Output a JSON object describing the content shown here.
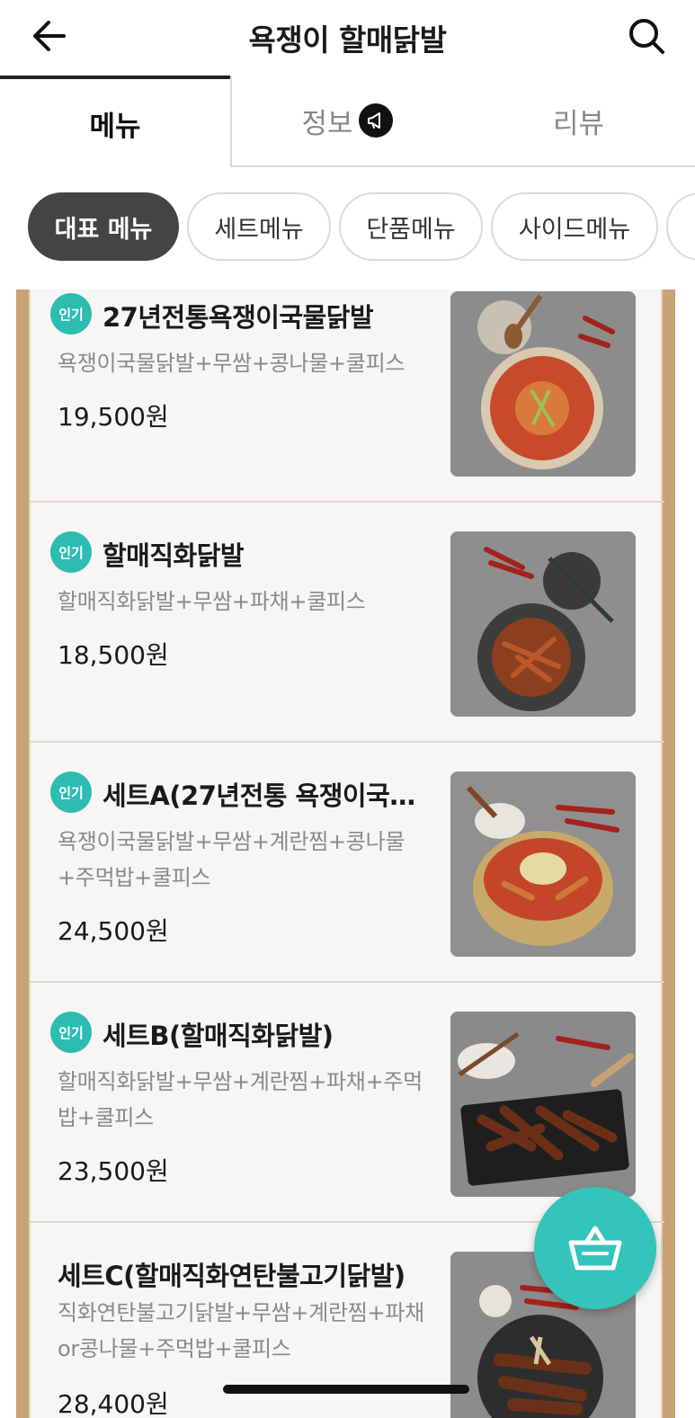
{
  "header": {
    "title": "욕쟁이 할매닭발",
    "back_icon": "arrow-left-icon",
    "search_icon": "search-icon"
  },
  "tabs": [
    {
      "label": "메뉴",
      "active": true
    },
    {
      "label": "정보",
      "active": false,
      "icon": "megaphone-icon"
    },
    {
      "label": "리뷰",
      "active": false
    }
  ],
  "categories": [
    {
      "label": "대표 메뉴",
      "active": true
    },
    {
      "label": "세트메뉴",
      "active": false
    },
    {
      "label": "단품메뉴",
      "active": false
    },
    {
      "label": "사이드메뉴",
      "active": false
    }
  ],
  "menu_items": [
    {
      "badge": "인기",
      "name": "27년전통욕쟁이국물닭발",
      "desc": "욕쟁이국물닭발+무쌈+콩나물+쿨피스",
      "price": "19,500원"
    },
    {
      "badge": "인기",
      "name": "할매직화닭발",
      "desc": "할매직화닭발+무쌈+파채+쿨피스",
      "price": "18,500원"
    },
    {
      "badge": "인기",
      "name": "세트A(27년전통 욕쟁이국…",
      "desc": "욕쟁이국물닭발+무쌈+계란찜+콩나물+주먹밥+쿨피스",
      "price": "24,500원"
    },
    {
      "badge": "인기",
      "name": "세트B(할매직화닭발)",
      "desc": "할매직화닭발+무쌈+계란찜+파채+주먹밥+쿨피스",
      "price": "23,500원"
    },
    {
      "badge": "",
      "name": "세트C(할매직화연탄불고기닭발)",
      "desc": "직화연탄불고기닭발+무쌈+계란찜+파채or콩나물+주먹밥+쿨피스",
      "price": "28,400원"
    }
  ],
  "cart": {
    "icon": "basket-icon"
  },
  "colors": {
    "accent": "#2cbcb2",
    "cart": "#34c4bb",
    "board_frame": "#c9a274",
    "active_chip": "#444444"
  }
}
